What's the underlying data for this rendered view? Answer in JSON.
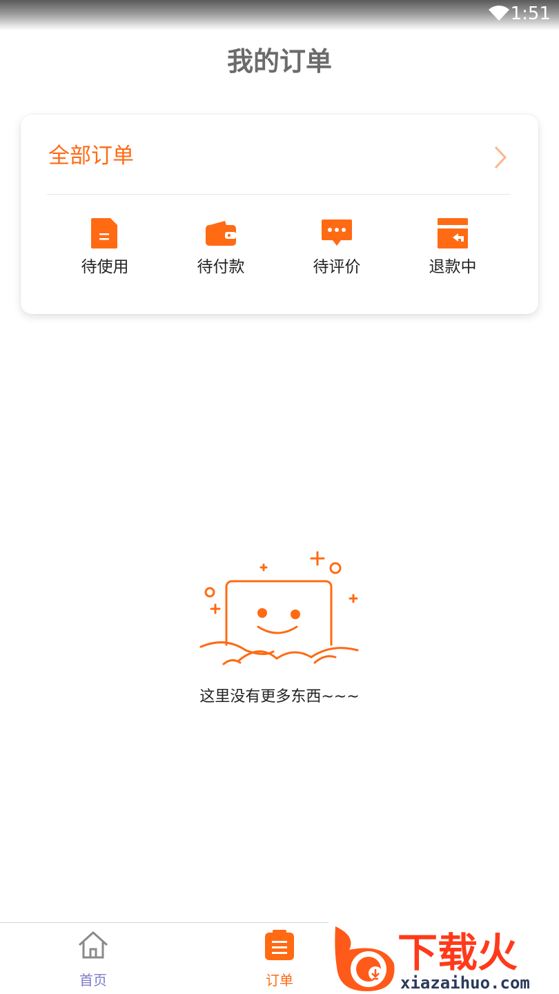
{
  "status_bar": {
    "time": "1:51"
  },
  "header": {
    "title": "我的订单"
  },
  "order_card": {
    "all_orders_label": "全部订单",
    "statuses": [
      {
        "label": "待使用",
        "icon": "document-icon"
      },
      {
        "label": "待付款",
        "icon": "wallet-icon"
      },
      {
        "label": "待评价",
        "icon": "comment-icon"
      },
      {
        "label": "退款中",
        "icon": "refund-card-icon"
      }
    ]
  },
  "empty_state": {
    "text": "这里没有更多东西~~~"
  },
  "bottom_nav": {
    "items": [
      {
        "label": "首页",
        "icon": "home-icon",
        "active": false
      },
      {
        "label": "订单",
        "icon": "orders-icon",
        "active": true
      }
    ]
  },
  "watermark": {
    "brand": "下载火",
    "domain": "xiazaihuo.com"
  },
  "colors": {
    "accent": "#ff6a13",
    "inactive_nav_label": "#7b7bc8",
    "text": "#222222",
    "title": "#6b6b6b"
  }
}
